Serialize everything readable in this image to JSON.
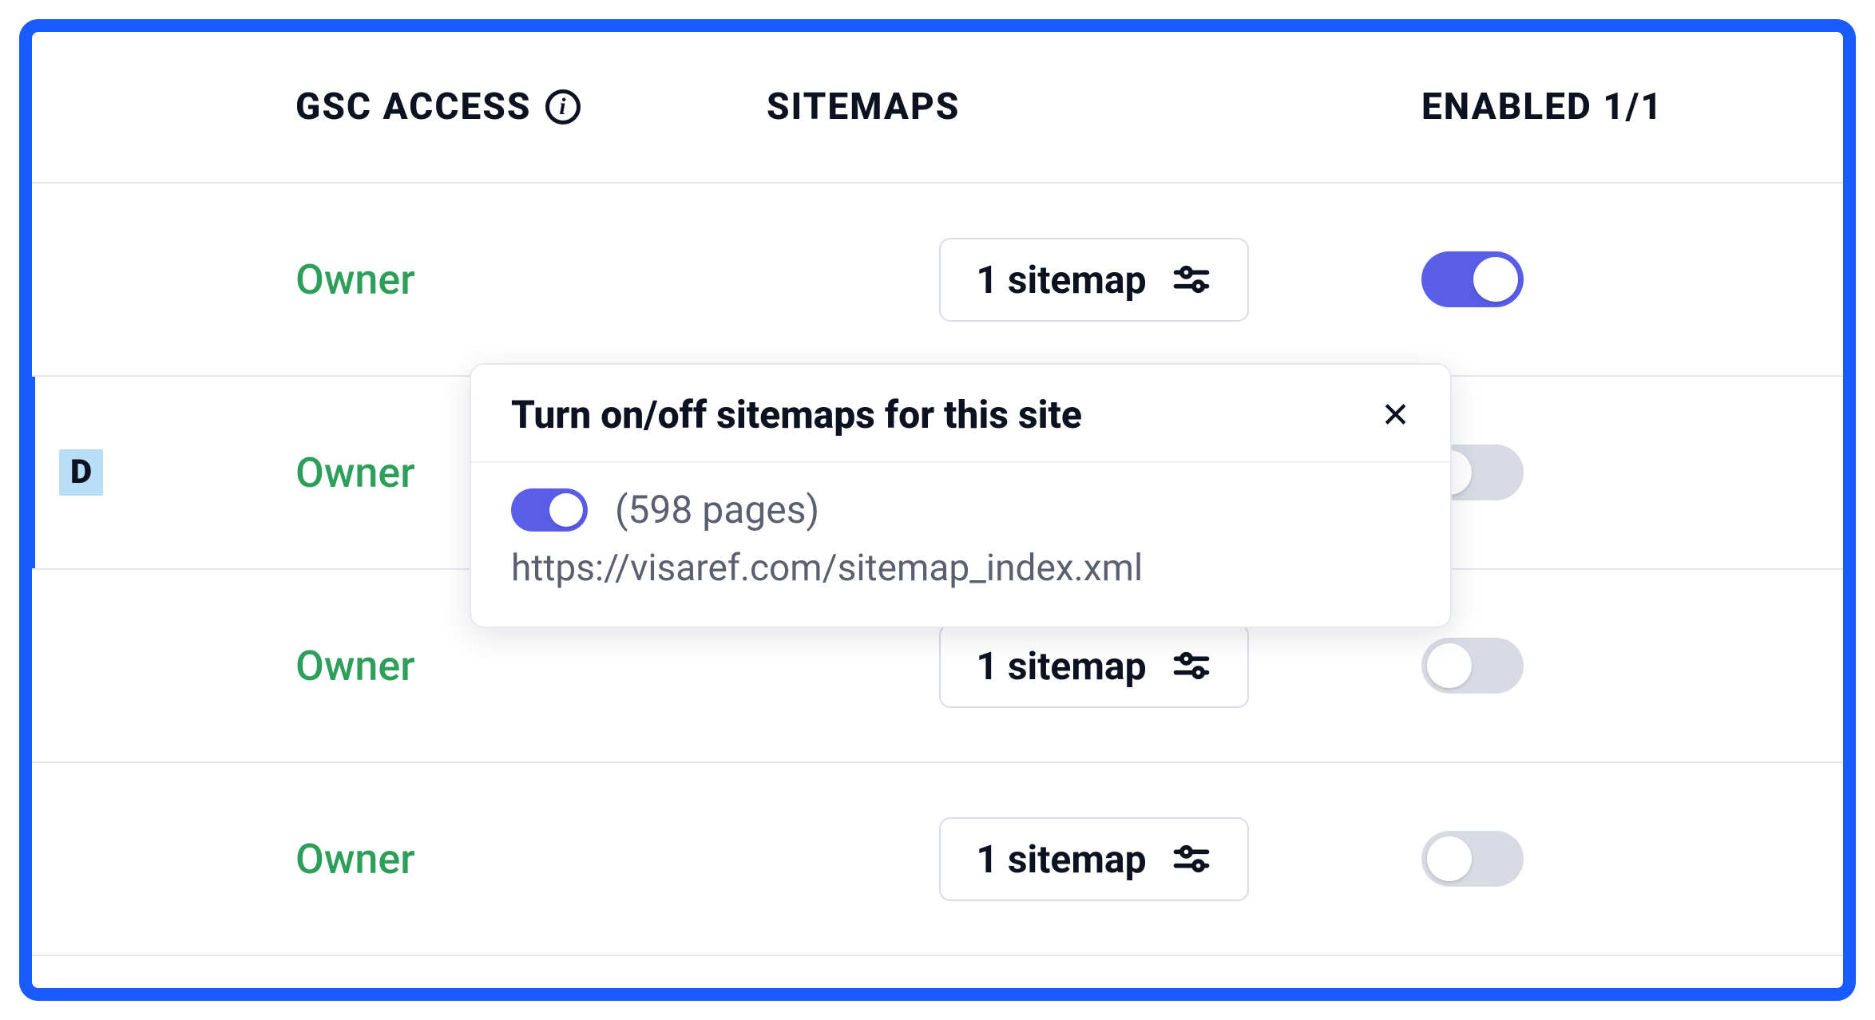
{
  "header": {
    "gsc_access": "GSC ACCESS",
    "sitemaps": "SITEMAPS",
    "enabled": "ENABLED 1/1"
  },
  "rows": [
    {
      "gsc": "Owner",
      "sitemap_label": "1 sitemap",
      "enabled": true,
      "selected": false,
      "badge": ""
    },
    {
      "gsc": "Owner",
      "sitemap_label": "",
      "enabled": false,
      "selected": true,
      "badge": "D"
    },
    {
      "gsc": "Owner",
      "sitemap_label": "1 sitemap",
      "enabled": false,
      "selected": false,
      "badge": ""
    },
    {
      "gsc": "Owner",
      "sitemap_label": "1 sitemap",
      "enabled": false,
      "selected": false,
      "badge": ""
    }
  ],
  "popover": {
    "title": "Turn on/off sitemaps for this site",
    "pages_label": "(598 pages)",
    "sitemap_url": "https://visaref.com/sitemap_index.xml",
    "item_enabled": true
  }
}
